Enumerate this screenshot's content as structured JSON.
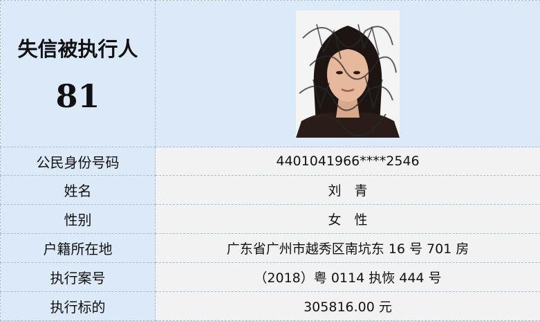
{
  "header": {
    "title": "失信被执行人",
    "number": "81"
  },
  "photo": {
    "description_icon": "portrait-photo-icon"
  },
  "rows": [
    {
      "label": "公民身份号码",
      "value": "4401041966****2546"
    },
    {
      "label": "姓名",
      "value": "刘　青"
    },
    {
      "label": "性别",
      "value": "女　性"
    },
    {
      "label": "户籍所在地",
      "value": "广东省广州市越秀区南坑东 16 号 701 房"
    },
    {
      "label": "执行案号",
      "value": "（2018）粤 0114 执恢 444 号"
    },
    {
      "label": "执行标的",
      "value": "305816.00 元"
    }
  ],
  "colors": {
    "label_bg": "#dbe9f8",
    "value_bg": "#f2f2f2",
    "border": "#a7bccf"
  }
}
